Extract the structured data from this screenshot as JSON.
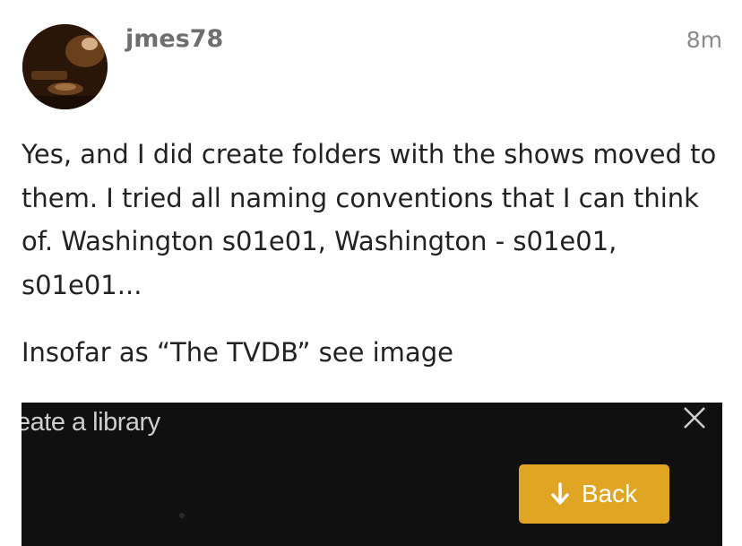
{
  "post": {
    "username": "jmes78",
    "timestamp": "8m",
    "paragraph1": "Yes, and I did create folders with the shows moved to them. I tried all naming conventions that I can think of. Washington s01e01, Washington - s01e01, s01e01...",
    "paragraph2": "Insofar as “The TVDB” see image"
  },
  "attachment": {
    "dialog_title": "eate a library",
    "back_button_label": "Back"
  },
  "colors": {
    "accent": "#e0a522",
    "username": "#6e6e6e",
    "timestamp": "#8a8a8a",
    "text": "#222222"
  },
  "icons": {
    "close": "close-icon",
    "back_arrow": "arrow-down-icon",
    "avatar": "avatar"
  }
}
